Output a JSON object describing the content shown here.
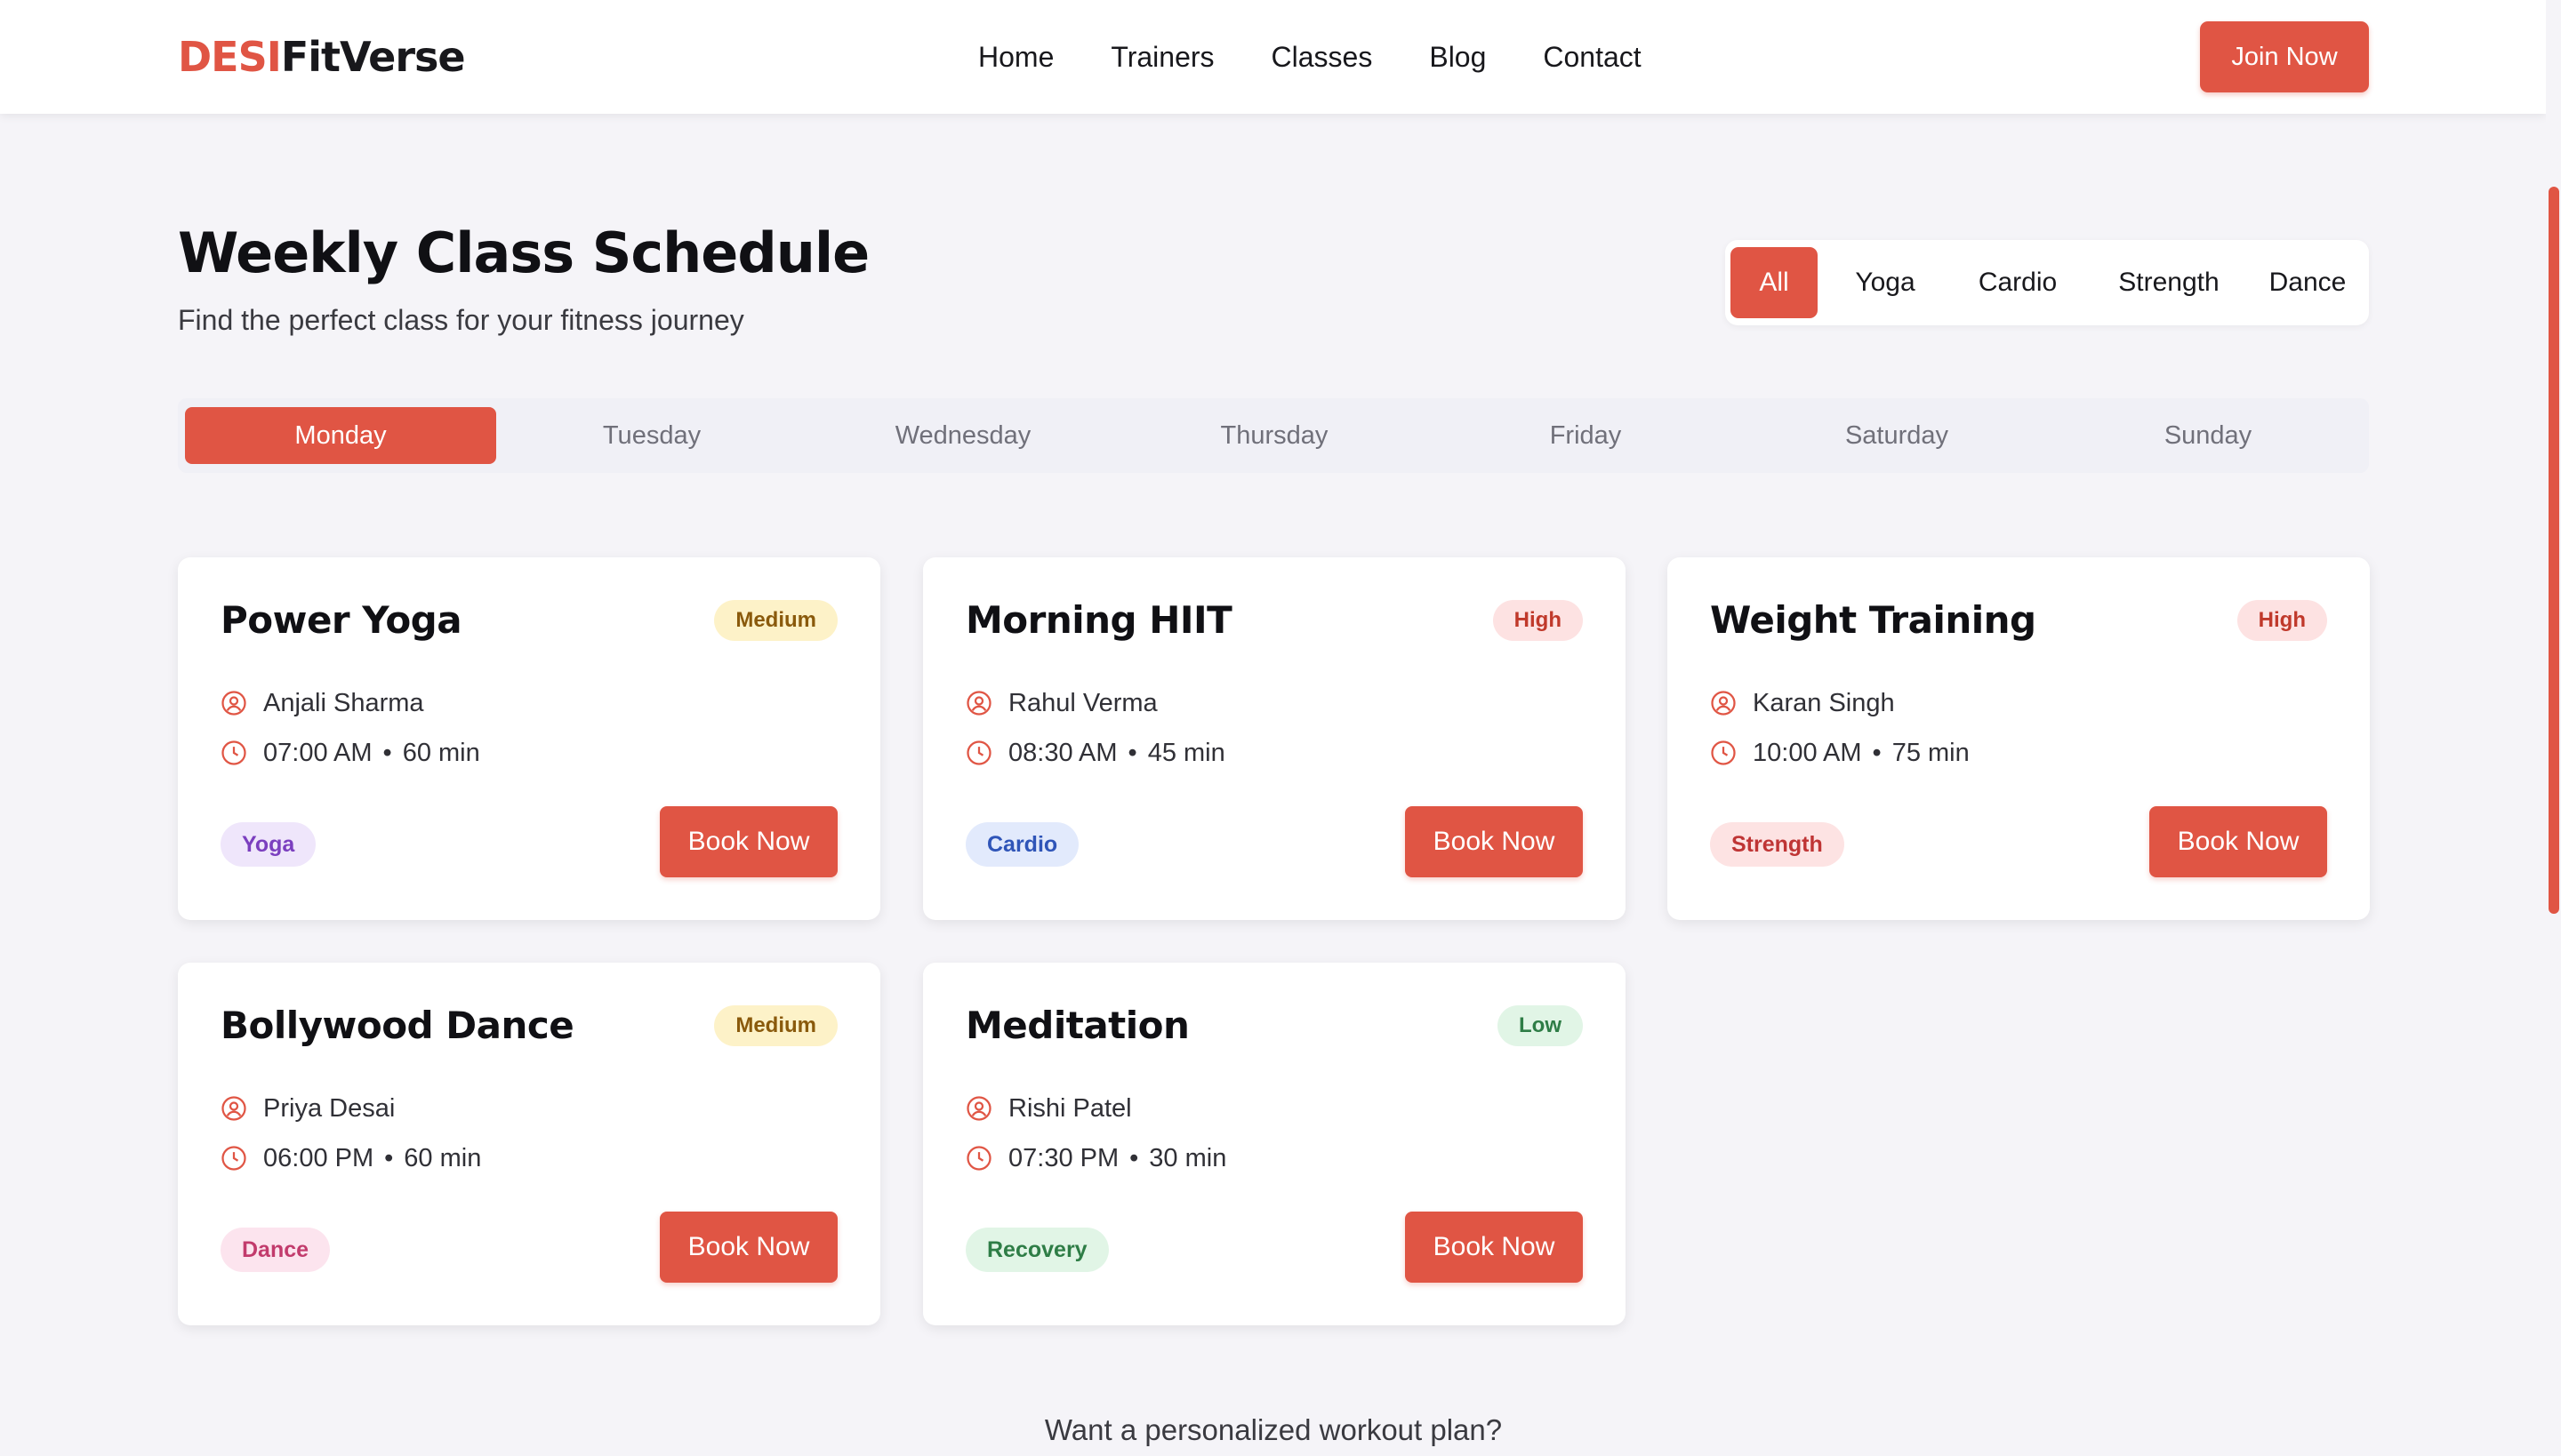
{
  "header": {
    "logo_part1": "DESI",
    "logo_part2": "FitVerse",
    "nav": [
      "Home",
      "Trainers",
      "Classes",
      "Blog",
      "Contact"
    ],
    "join_label": "Join Now"
  },
  "title": "Weekly Class Schedule",
  "subtitle": "Find the perfect class for your fitness journey",
  "filters": {
    "items": [
      "All",
      "Yoga",
      "Cardio",
      "Strength",
      "Dance"
    ],
    "active": "All"
  },
  "days": {
    "items": [
      "Monday",
      "Tuesday",
      "Wednesday",
      "Thursday",
      "Friday",
      "Saturday",
      "Sunday"
    ],
    "active": "Monday"
  },
  "classes": [
    {
      "name": "Power Yoga",
      "intensity": "Medium",
      "trainer": "Anjali Sharma",
      "time": "07:00 AM",
      "duration": "60 min",
      "tag": "Yoga",
      "button": "Book Now"
    },
    {
      "name": "Morning HIIT",
      "intensity": "High",
      "trainer": "Rahul Verma",
      "time": "08:30 AM",
      "duration": "45 min",
      "tag": "Cardio",
      "button": "Book Now"
    },
    {
      "name": "Weight Training",
      "intensity": "High",
      "trainer": "Karan Singh",
      "time": "10:00 AM",
      "duration": "75 min",
      "tag": "Strength",
      "button": "Book Now"
    },
    {
      "name": "Bollywood Dance",
      "intensity": "Medium",
      "trainer": "Priya Desai",
      "time": "06:00 PM",
      "duration": "60 min",
      "tag": "Dance",
      "button": "Book Now"
    },
    {
      "name": "Meditation",
      "intensity": "Low",
      "trainer": "Rishi Patel",
      "time": "07:30 PM",
      "duration": "30 min",
      "tag": "Recovery",
      "button": "Book Now"
    }
  ],
  "footer_prompt": "Want a personalized workout plan?",
  "colors": {
    "accent": "#e05544",
    "intensity": {
      "Medium": {
        "bg": "#fdf2c8",
        "fg": "#8a5a0c"
      },
      "High": {
        "bg": "#fde2e2",
        "fg": "#c0392b"
      },
      "Low": {
        "bg": "#e1f5e6",
        "fg": "#2e7d46"
      }
    },
    "tags": {
      "Yoga": {
        "bg": "#efe6fb",
        "fg": "#7b3fbf"
      },
      "Cardio": {
        "bg": "#e2eafc",
        "fg": "#2f55b8"
      },
      "Strength": {
        "bg": "#fde3e3",
        "fg": "#bf3535"
      },
      "Dance": {
        "bg": "#fce4ee",
        "fg": "#c23b6c"
      },
      "Recovery": {
        "bg": "#e1f5e6",
        "fg": "#2e7d46"
      }
    }
  },
  "icons": {
    "trainer": "user-circle-icon",
    "time": "clock-icon"
  }
}
